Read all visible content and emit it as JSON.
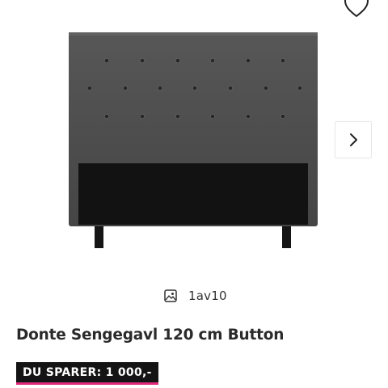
{
  "gallery": {
    "image_alt": "Donte Sengegavl 120 cm Button",
    "counter": {
      "current": "1",
      "separator": "av",
      "total": "10"
    }
  },
  "product": {
    "title": "Donte Sengegavl 120 cm Button",
    "savings_badge": "DU SPARER: 1 000,-"
  },
  "icons": {
    "wishlist": "heart-outline-icon",
    "next": "chevron-right-icon",
    "counter": "image-icon"
  },
  "colors": {
    "headboard_fabric": "#4a4a4a",
    "headboard_base": "#141414",
    "badge_background": "#141414",
    "badge_accent": "#e0287d"
  }
}
